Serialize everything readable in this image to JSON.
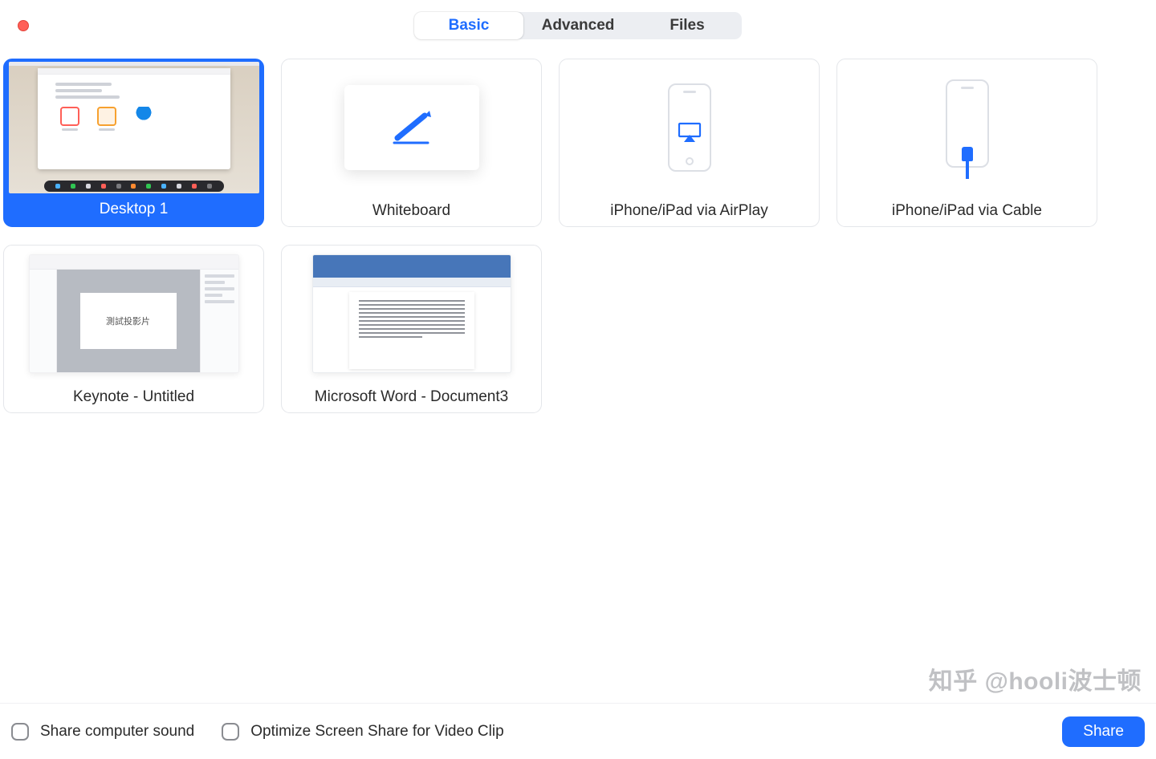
{
  "tabs": {
    "basic": "Basic",
    "advanced": "Advanced",
    "files": "Files"
  },
  "tiles": {
    "desktop1": "Desktop 1",
    "whiteboard": "Whiteboard",
    "airplay": "iPhone/iPad via AirPlay",
    "cable": "iPhone/iPad via Cable",
    "keynote": "Keynote - Untitled",
    "keynote_slide_text": "測試投影片",
    "word": "Microsoft Word - Document3"
  },
  "footer": {
    "share_sound": "Share computer sound",
    "optimize_clip": "Optimize Screen Share for Video Clip",
    "share_button": "Share"
  },
  "watermark": "知乎 @hooli波士顿",
  "colors": {
    "accent": "#1f6dff",
    "close_dot": "#ff5f57"
  }
}
